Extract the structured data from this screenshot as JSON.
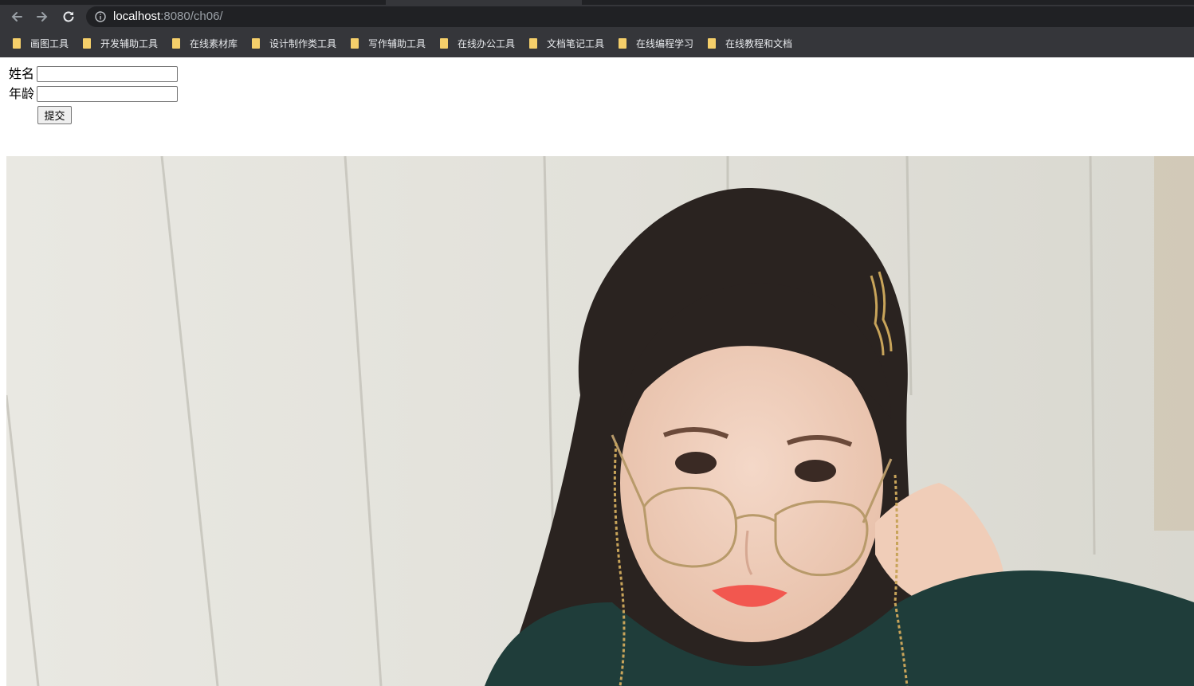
{
  "browser": {
    "url_host": "localhost",
    "url_path": ":8080/ch06/",
    "icons": {
      "back": "arrow-left-icon",
      "forward": "arrow-right-icon",
      "reload": "reload-icon",
      "site_info": "info-icon",
      "bookmark_folder": "folder-icon"
    },
    "bookmarks": [
      {
        "label": "画图工具"
      },
      {
        "label": "开发辅助工具"
      },
      {
        "label": "在线素材库"
      },
      {
        "label": "设计制作类工具"
      },
      {
        "label": "写作辅助工具"
      },
      {
        "label": "在线办公工具"
      },
      {
        "label": "文档笔记工具"
      },
      {
        "label": "在线编程学习"
      },
      {
        "label": "在线教程和文档"
      }
    ]
  },
  "form": {
    "name_label": "姓名",
    "name_value": "",
    "age_label": "年龄",
    "age_value": "",
    "submit_label": "提交"
  },
  "photo": {
    "description_icon": "portrait-photo"
  },
  "colors": {
    "chrome_dark": "#35363a",
    "omnibox": "#202124",
    "folder": "#f5cf6a"
  }
}
